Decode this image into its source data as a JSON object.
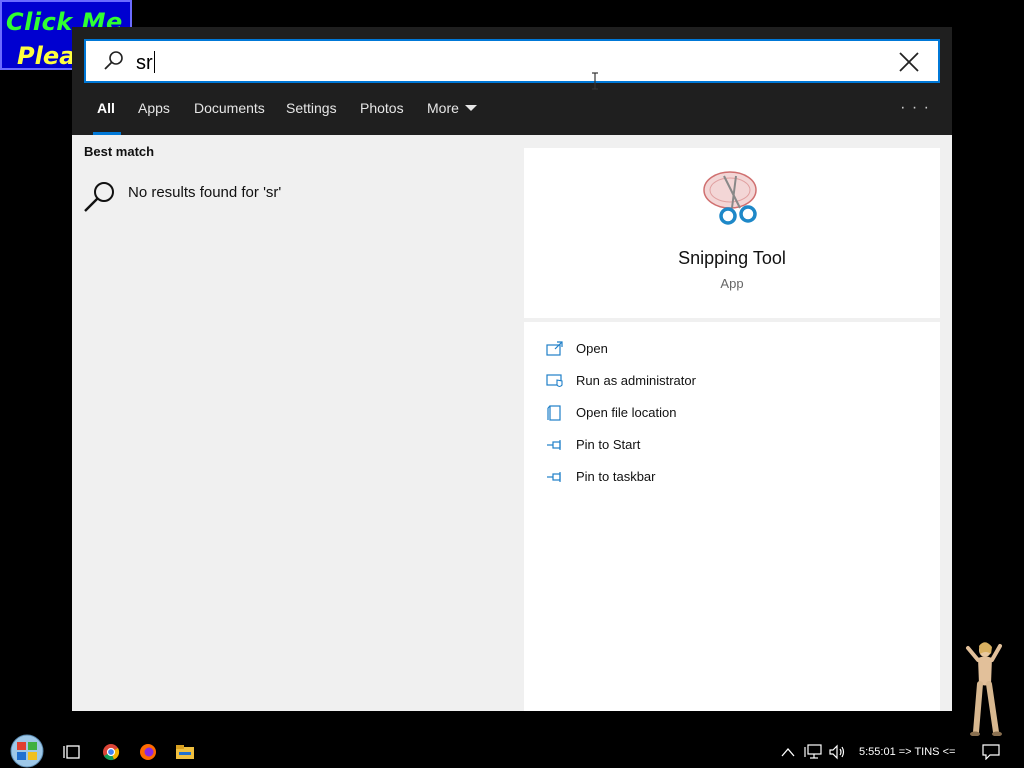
{
  "banner": {
    "line1": "Click Me",
    "line2": "Pleas"
  },
  "search": {
    "query": "sr"
  },
  "tabs": [
    {
      "label": "All"
    },
    {
      "label": "Apps"
    },
    {
      "label": "Documents"
    },
    {
      "label": "Settings"
    },
    {
      "label": "Photos"
    },
    {
      "label": "More"
    }
  ],
  "results": {
    "section_title": "Best match",
    "no_results": "No results found for 'sr'"
  },
  "detail": {
    "app_name": "Snipping Tool",
    "app_type": "App",
    "actions": [
      {
        "label": "Open",
        "icon": "open-icon"
      },
      {
        "label": "Run as administrator",
        "icon": "admin-shield-icon"
      },
      {
        "label": "Open file location",
        "icon": "file-location-icon"
      },
      {
        "label": "Pin to Start",
        "icon": "pin-icon"
      },
      {
        "label": "Pin to taskbar",
        "icon": "pin-icon"
      }
    ]
  },
  "taskbar": {
    "clock": "5:55:01 => TINS <=",
    "icons": [
      "start-orb-icon",
      "task-view-icon",
      "chrome-icon",
      "firefox-icon",
      "file-explorer-icon"
    ]
  },
  "colors": {
    "accent": "#0078d7",
    "header_bg": "#1f1f1f",
    "panel_bg": "#f0f0f0"
  }
}
